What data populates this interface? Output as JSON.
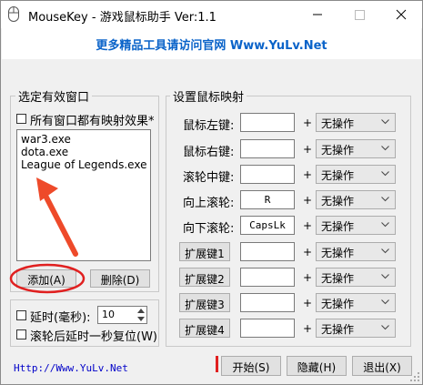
{
  "window": {
    "title": "MouseKey - 游戏鼠标助手 Ver:1.1"
  },
  "banner": {
    "text": "更多精品工具请访问官网  Www.YuLv.Net"
  },
  "colors": {
    "banner": "#0a63c9",
    "arrow": "#ee4a2a",
    "highlight": "#e02020",
    "link": "#0000c8"
  },
  "left_group": {
    "title": "选定有效窗口",
    "all_windows_checkbox": "所有窗口都有映射效果*",
    "list_items": [
      "war3.exe",
      "dota.exe",
      "League of Legends.exe"
    ],
    "add_button": "添加(A)",
    "delete_button": "删除(D)"
  },
  "delay_group": {
    "delay_label": "延时(毫秒):",
    "delay_value": "10",
    "wheel_reset_label": "滚轮后延时一秒复位(W)"
  },
  "right_group": {
    "title": "设置鼠标映射",
    "rows": [
      {
        "label": "鼠标左键:",
        "key": "",
        "action": "无操作"
      },
      {
        "label": "鼠标右键:",
        "key": "",
        "action": "无操作"
      },
      {
        "label": "滚轮中键:",
        "key": "",
        "action": "无操作"
      },
      {
        "label": "向上滚轮:",
        "key": "R",
        "action": "无操作"
      },
      {
        "label": "向下滚轮:",
        "key": "CapsLk",
        "action": "无操作"
      },
      {
        "label": "扩展键1",
        "key": "",
        "action": "无操作"
      },
      {
        "label": "扩展键2",
        "key": "",
        "action": "无操作"
      },
      {
        "label": "扩展键3",
        "key": "",
        "action": "无操作"
      },
      {
        "label": "扩展键4",
        "key": "",
        "action": "无操作"
      }
    ],
    "plus": "+"
  },
  "footer": {
    "link": "Http://Www.YuLv.Net",
    "start_button": "开始(S)",
    "hide_button": "隐藏(H)",
    "exit_button": "退出(X)"
  }
}
